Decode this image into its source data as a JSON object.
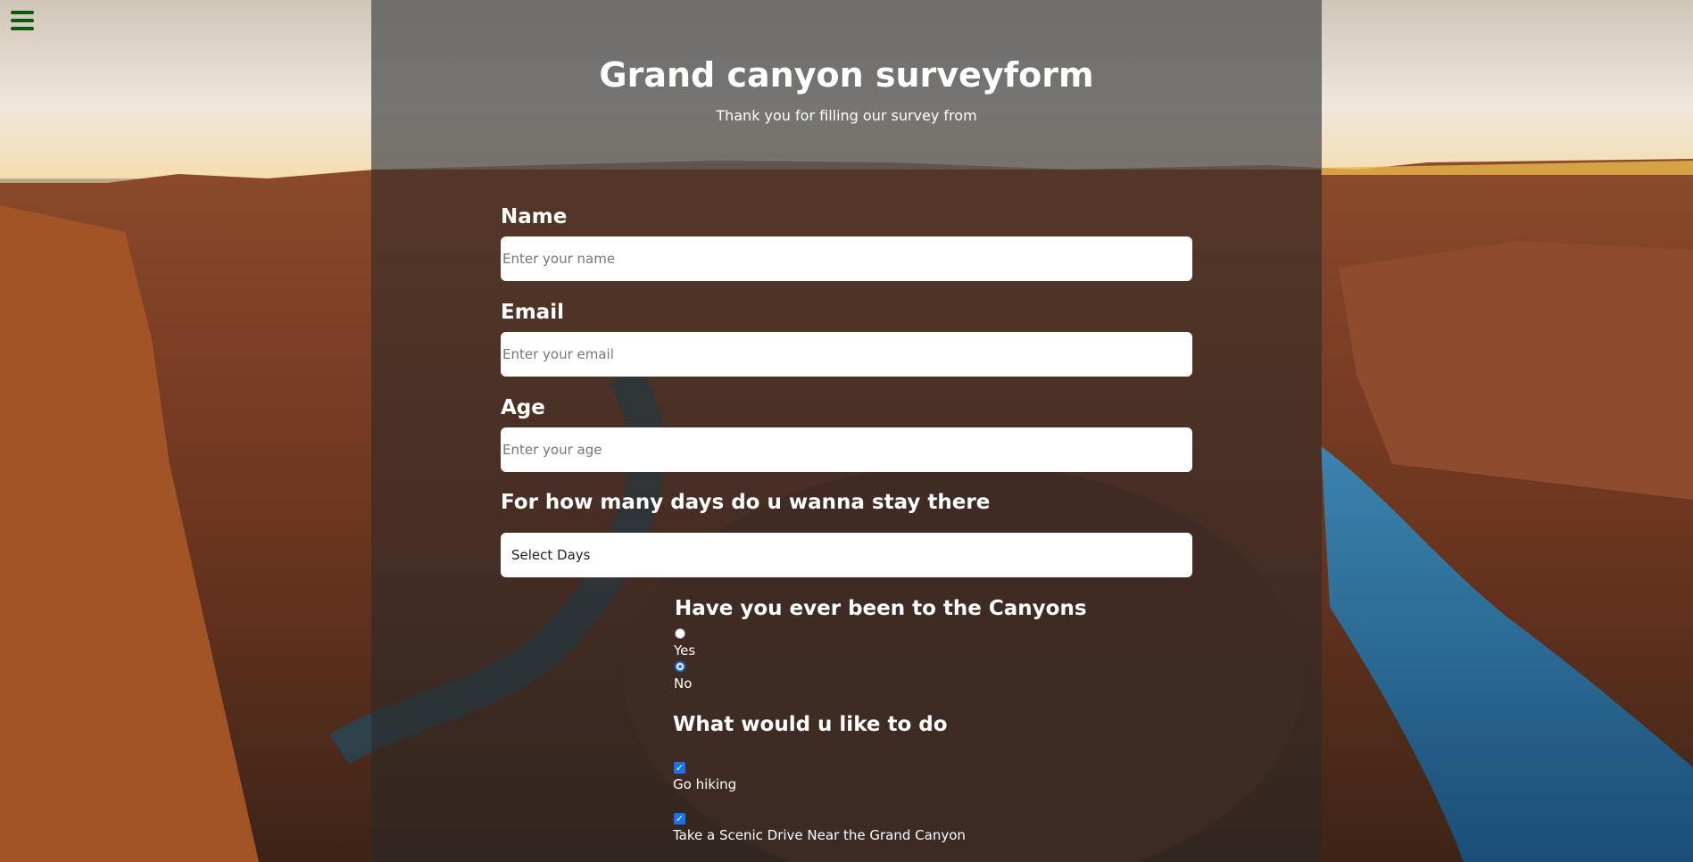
{
  "header": {
    "title": "Grand canyon surveyform",
    "subtitle": "Thank you for filling our survey from"
  },
  "form": {
    "name_label": "Name",
    "name_placeholder": "Enter your name",
    "email_label": "Email",
    "email_placeholder": "Enter your email",
    "age_label": "Age",
    "age_placeholder": "Enter your age",
    "days_label": "For how many days do u wanna stay there",
    "days_selected": "Select Days",
    "visited_question": "Have you ever been to the Canyons",
    "visited_options": [
      {
        "label": "Yes",
        "checked": false
      },
      {
        "label": "No",
        "checked": true
      }
    ],
    "activities_question": "What would u like to do",
    "activities": [
      {
        "label": "Go hiking",
        "checked": true
      },
      {
        "label": "Take a Scenic Drive Near the Grand Canyon",
        "checked": true
      }
    ]
  },
  "icons": {
    "menu": "hamburger-menu-icon",
    "checkmark": "✓"
  },
  "colors": {
    "menu_icon": "#0b5a0b",
    "accent": "#1a73e8"
  }
}
